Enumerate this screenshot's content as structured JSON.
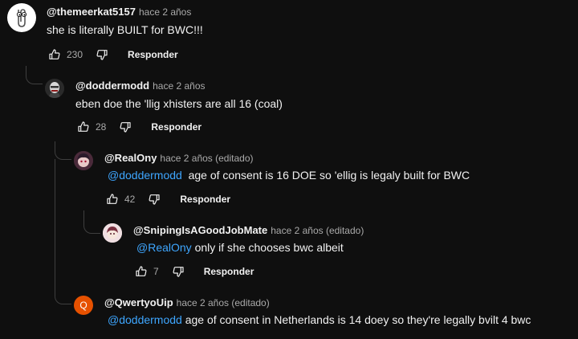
{
  "comments": [
    {
      "handle": "@themeerkat5157",
      "meta": "hace 2 años",
      "mention": "",
      "text": "she is literally BUILT for BWC!!!",
      "likes": "230",
      "reply_label": "Responder",
      "avatar_icon": "paperclip-icon"
    },
    {
      "handle": "@doddermodd",
      "meta": "hace 2 años",
      "mention": "",
      "text": "eben doe the 'llig xhisters are all 16 (coal)",
      "likes": "28",
      "reply_label": "Responder",
      "avatar_icon": "masked-figure-icon"
    },
    {
      "handle": "@RealOny",
      "meta": "hace 2 años (editado)",
      "mention": "@doddermodd",
      "text": "age of consent is 16 DOE so 'ellig is legaly built for BWC",
      "likes": "42",
      "reply_label": "Responder",
      "avatar_icon": "anime-avatar-icon"
    },
    {
      "handle": "@SnipingIsAGoodJobMate",
      "meta": "hace 2 años (editado)",
      "mention": "@RealOny",
      "text": "only if she chooses bwc albeit",
      "likes": "7",
      "reply_label": "Responder",
      "avatar_icon": "anime-avatar-icon"
    },
    {
      "handle": "@QwertyoUip",
      "meta": "hace 2 años (editado)",
      "mention": "@doddermodd",
      "text": "age of consent in Netherlands is 14 doey so they're legally bvilt 4 bwc",
      "avatar_letter": "Q",
      "avatar_color": "#e65100"
    }
  ]
}
